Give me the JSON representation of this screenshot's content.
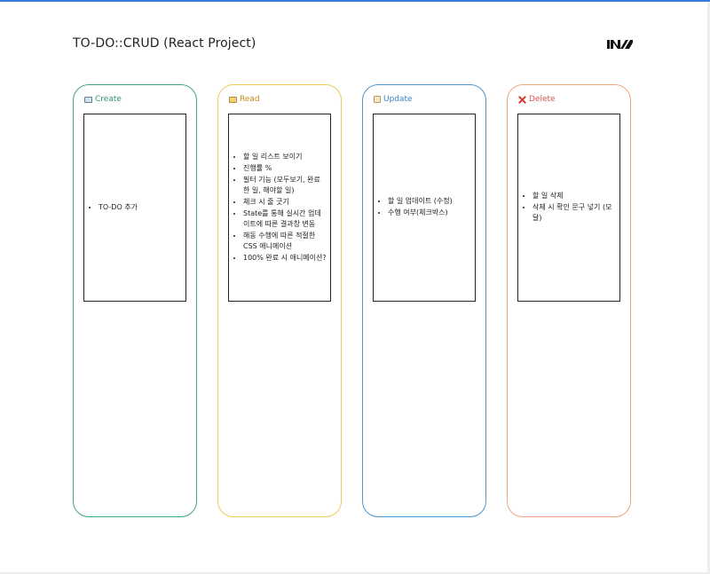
{
  "page": {
    "title": "TO-DO::CRUD (React Project)"
  },
  "logo": {
    "icon": "brand-logo-icon"
  },
  "columns": [
    {
      "header": "Create",
      "icon": "computer-icon",
      "color": "#3ea676",
      "items": [
        "TO-DO 추가"
      ]
    },
    {
      "header": "Read",
      "icon": "book-icon",
      "color": "#efc95a",
      "items": [
        "할 일 리스트 보이기",
        "진행률 %",
        "필터 기능 (모두보기, 완료한 일, 해야할 일)",
        "체크 시 줄 긋기",
        "State를 통해 실시간 업데이트에 따른 결과창 변동",
        "해동 수행에 따른 적절한 CSS 애니메이션",
        "100% 완료 시 애니메이션?"
      ]
    },
    {
      "header": "Update",
      "icon": "memo-icon",
      "color": "#4a97d6",
      "items": [
        "할 일 업데이트 (수정)",
        "수행 여부(체크박스)"
      ]
    },
    {
      "header": "Delete",
      "icon": "cross-mark-icon",
      "color": "#f0a67a",
      "items": [
        "할 일 삭제",
        "삭제 시 확인 문구 넣기 (모달)"
      ]
    }
  ]
}
